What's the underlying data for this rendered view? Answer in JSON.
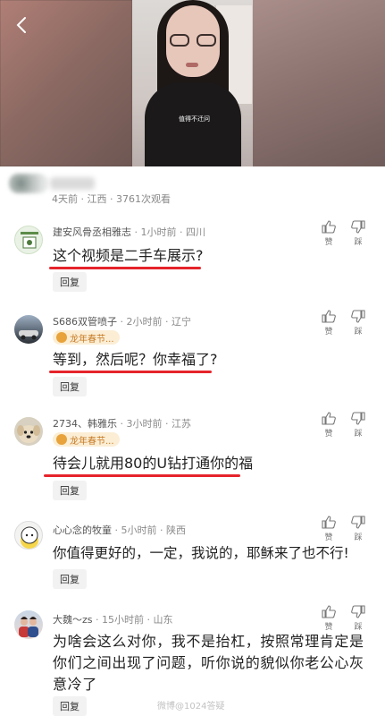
{
  "nav": {
    "back_icon": "chevron-left-icon"
  },
  "video": {
    "caption": "值得不迁问"
  },
  "post_meta": {
    "text": "4天前 · 江西 · 3761次观看"
  },
  "actions": {
    "like_label": "赞",
    "dislike_label": "踩"
  },
  "reply_label": "回复",
  "comments": [
    {
      "name": "建安风骨丞相雅志",
      "time": "1小时前",
      "location": "四川",
      "text": "这个视频是二手车展示?",
      "badge": ""
    },
    {
      "name": "S686双管喷子",
      "time": "2小时前",
      "location": "辽宁",
      "text": "等到，然后呢？你幸福了?",
      "badge": "龙年春节..."
    },
    {
      "name": "2734、韩雅乐",
      "time": "3小时前",
      "location": "江苏",
      "text": "待会儿就用80的U钻打通你的福",
      "badge": "龙年春节..."
    },
    {
      "name": "心心念的牧童",
      "time": "5小时前",
      "location": "陕西",
      "text": "你值得更好的，一定，我说的，耶稣来了也不行!",
      "badge": ""
    },
    {
      "name": "大魏～zs",
      "time": "15小时前",
      "location": "山东",
      "text": "为啥会这么对你，我不是抬杠，按照常理肯定是你们之间出现了问题，听你说的貌似你老公心灰意冷了",
      "badge": ""
    }
  ],
  "watermark": "微博@1024答疑",
  "colors": {
    "highlight_red": "#e5242b",
    "badge_bg": "#fbeed5",
    "badge_text": "#c77a24"
  }
}
